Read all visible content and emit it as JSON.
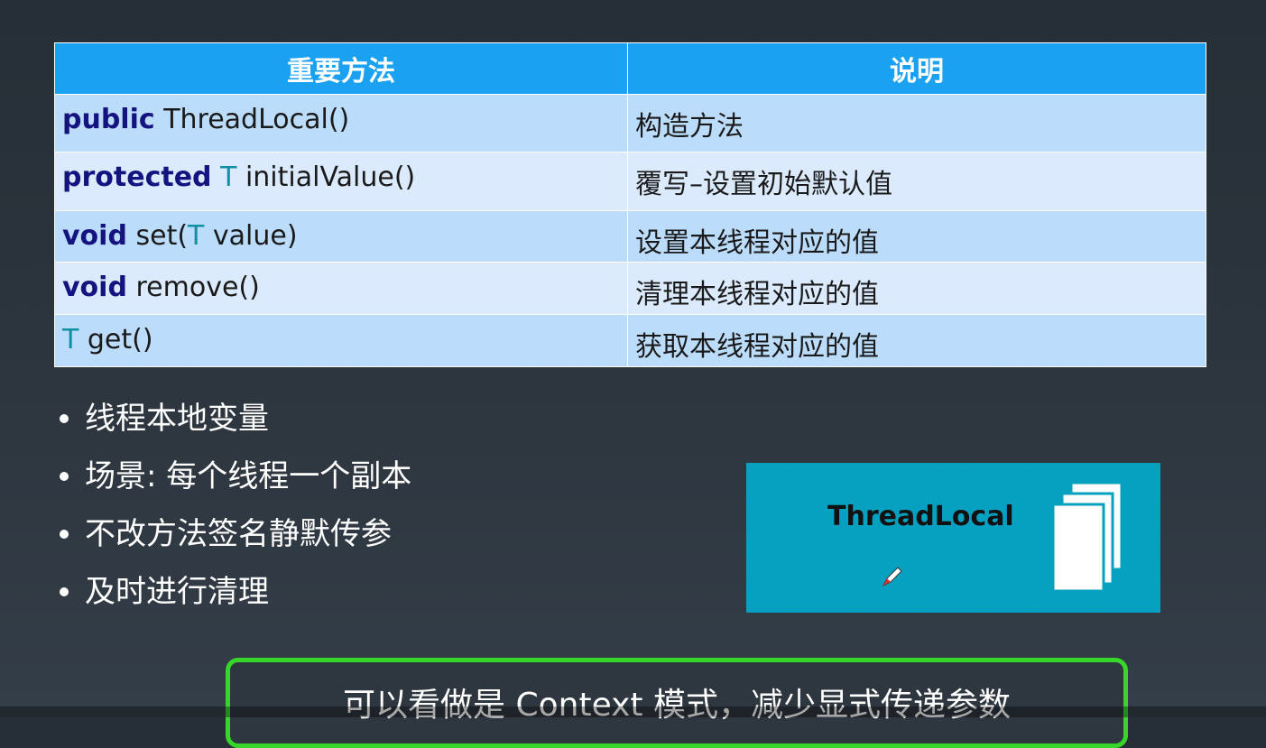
{
  "table": {
    "headers": [
      "重要方法",
      "说明"
    ],
    "rows": [
      {
        "kw": "public",
        "type": "",
        "rest": "ThreadLocal()",
        "desc": "构造方法"
      },
      {
        "kw": "protected",
        "type": "T",
        "rest": "initialValue()",
        "desc": "覆写–设置初始默认值"
      },
      {
        "kw": "void",
        "type": "",
        "rest": "set(",
        "type2": "T",
        "rest2": "value)",
        "desc": "设置本线程对应的值"
      },
      {
        "kw": "void",
        "type": "",
        "rest": "remove()",
        "desc": "清理本线程对应的值"
      },
      {
        "kw": "",
        "type": "T",
        "rest": "get()",
        "desc": "获取本线程对应的值"
      }
    ]
  },
  "bullets": [
    "线程本地变量",
    "场景: 每个线程一个副本",
    "不改方法签名静默传参",
    "及时进行清理"
  ],
  "card": {
    "title": "ThreadLocal",
    "icons": [
      "pen-icon",
      "stacked-pages-icon"
    ]
  },
  "summary": "可以看做是 Context 模式，减少显式传递参数",
  "colors": {
    "header": "#1ba1f2",
    "card": "#06a1c0",
    "summary_border": "#38d52a",
    "keyword": "#15137f",
    "type": "#0f8fa3"
  }
}
